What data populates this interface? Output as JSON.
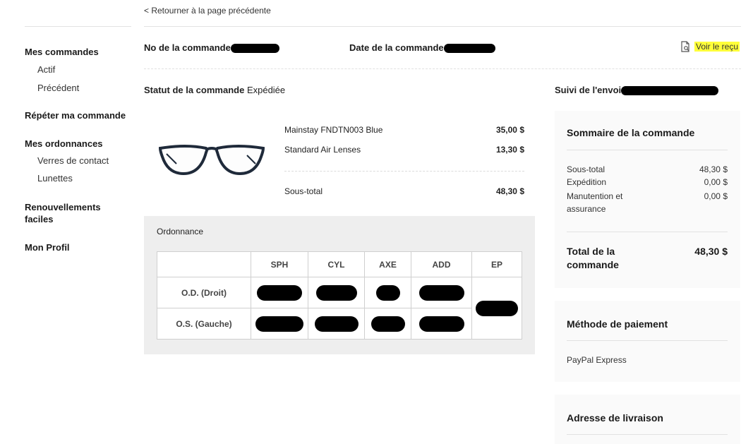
{
  "nav": {
    "back_label": "< Retourner à la page précédente"
  },
  "sidebar": {
    "orders": "Mes commandes",
    "active": "Actif",
    "previous": "Précédent",
    "repeat": "Répéter ma commande",
    "prescriptions": "Mes ordonnances",
    "contacts": "Verres de contact",
    "glasses": "Lunettes",
    "renewals": "Renouvellements faciles",
    "profile": "Mon Profil"
  },
  "order": {
    "number_label": "No de la commande",
    "date_label": "Date de la commande",
    "receipt_label": "Voir le reçu",
    "status_label": "Statut de la commande",
    "status_value": "Expédiée",
    "tracking_label": "Suivi de l'envoi"
  },
  "items": [
    {
      "name": "Mainstay FNDTN003 Blue",
      "price": "35,00 $"
    },
    {
      "name": "Standard Air Lenses",
      "price": "13,30 $"
    }
  ],
  "item_subtotal": {
    "label": "Sous-total",
    "value": "48,30 $"
  },
  "prescription": {
    "title": "Ordonnance",
    "headers": [
      "SPH",
      "CYL",
      "AXE",
      "ADD",
      "EP"
    ],
    "rows": [
      {
        "label": "O.D. (Droit)"
      },
      {
        "label": "O.S. (Gauche)"
      }
    ]
  },
  "summary": {
    "title": "Sommaire de la commande",
    "subtotal_label": "Sous-total",
    "subtotal_value": "48,30 $",
    "shipping_label": "Expédition",
    "shipping_value": "0,00 $",
    "handling_label": "Manutention et assurance",
    "handling_value": "0,00 $",
    "total_label": "Total de la commande",
    "total_value": "48,30 $"
  },
  "payment": {
    "title": "Méthode de paiement",
    "method": "PayPal Express"
  },
  "delivery": {
    "title": "Adresse de livraison"
  },
  "colors": {
    "highlight": "#ffff3a",
    "panel_gray": "#eeeeee",
    "redaction": "#000000"
  }
}
